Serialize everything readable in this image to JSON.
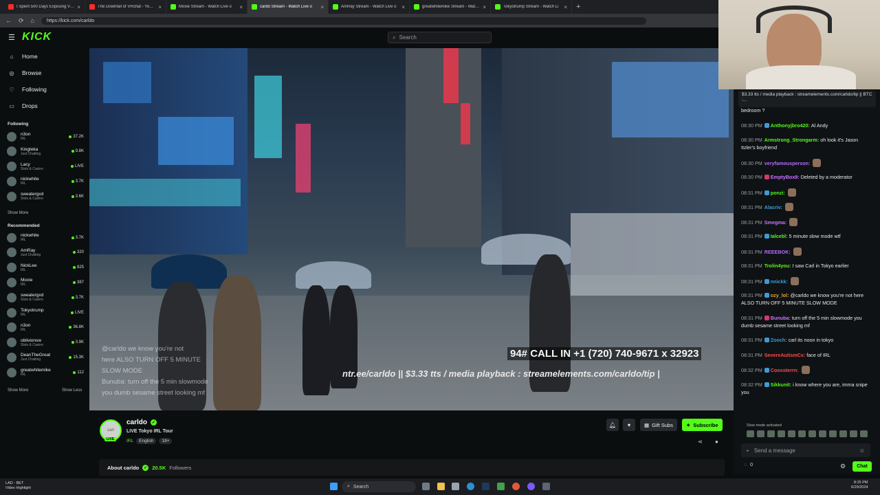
{
  "browser": {
    "tabs": [
      {
        "title": "I Spent 500 Days Exposing VRChat",
        "favicon_color": "#ff2b2b",
        "active": false
      },
      {
        "title": "The Downfall of VRchat - YouTube",
        "favicon_color": "#ff2b2b",
        "active": false
      },
      {
        "title": "Moxie Stream - Watch Live o",
        "favicon_color": "#53fc18",
        "active": false
      },
      {
        "title": "cardo Stream - Watch Live o",
        "favicon_color": "#53fc18",
        "active": true
      },
      {
        "title": "AmRay Stream - Watch Live o",
        "favicon_color": "#53fc18",
        "active": false
      },
      {
        "title": "greatwhitemike Stream - Watch Li",
        "favicon_color": "#53fc18",
        "active": false
      },
      {
        "title": "Tokyotrump Stream - Watch Li",
        "favicon_color": "#53fc18",
        "active": false
      }
    ],
    "url": "https://kick.com/carldo",
    "new_tab": "+"
  },
  "header": {
    "logo": "KICK",
    "search_placeholder": "Search"
  },
  "sidebar": {
    "nav": [
      {
        "label": "Home",
        "icon": "home-icon",
        "glyph": "⌂"
      },
      {
        "label": "Browse",
        "icon": "browse-icon",
        "glyph": "◎"
      },
      {
        "label": "Following",
        "icon": "heart-icon",
        "glyph": "♡"
      },
      {
        "label": "Drops",
        "icon": "drops-icon",
        "glyph": "▭"
      }
    ],
    "following_title": "Following",
    "following": [
      {
        "name": "n3on",
        "category": "IRL",
        "viewers": "37.2K"
      },
      {
        "name": "Kingteka",
        "category": "Just Chatting",
        "viewers": "9.8K"
      },
      {
        "name": "Lacy",
        "category": "Slots & Casino",
        "viewers": "LIVE"
      },
      {
        "name": "nickwhite",
        "category": "IRL",
        "viewers": "3.7K"
      },
      {
        "name": "sweatergxd",
        "category": "Slots & Casino",
        "viewers": "3.6K"
      }
    ],
    "show_more_1": "Show More",
    "recommended_title": "Recommended",
    "recommended": [
      {
        "name": "nickwhite",
        "category": "IRL",
        "viewers": "3.7K"
      },
      {
        "name": "AmRay",
        "category": "Just Chatting",
        "viewers": "320"
      },
      {
        "name": "NickLee",
        "category": "IRL",
        "viewers": "825"
      },
      {
        "name": "Moxie",
        "category": "IRL",
        "viewers": "387"
      },
      {
        "name": "sweatergxd",
        "category": "Slots & Casino",
        "viewers": "3.7K"
      },
      {
        "name": "Tokyotrump",
        "category": "IRL",
        "viewers": "LIVE"
      },
      {
        "name": "n3on",
        "category": "IRL",
        "viewers": "36.8K"
      },
      {
        "name": "oblivionsw",
        "category": "Slots & Casino",
        "viewers": "3.9K"
      },
      {
        "name": "DeanTheGreat",
        "category": "Just Chatting",
        "viewers": "15.3K"
      },
      {
        "name": "greatwhitemike",
        "category": "IRL",
        "viewers": "112"
      }
    ],
    "show_more_2": "Show More",
    "show_less": "Show Less"
  },
  "video": {
    "overlay_chat": [
      "@carldo we know you're not",
      "here ALSO TURN OFF 5 MINUTE",
      "SLOW MODE",
      "Bunuba: turn off the 5 min slowmode",
      "you dumb sesame street looking mf"
    ],
    "ticker_line1": "94#  CALL IN +1 (720) 740-9671 x 32923",
    "ticker_line2": "ntr.ee/carldo || $3.33 tts / media playback : streamelements.com/carldo/tip |"
  },
  "stream": {
    "avatar_text": "carl",
    "live_badge": "LIVE",
    "name": "carldo",
    "title": "LIVE Tokyo IRL Tour",
    "category": "IRL",
    "language": "English",
    "rating": "18+",
    "gift_label": "Gift Subs",
    "subscribe_label": "Subscribe",
    "about_label": "About carldo",
    "followers_count": "20.5K",
    "followers_label": "Followers"
  },
  "chat": {
    "pinned": "$3.33 tts / media playback : streamelements.com/carldo/tip || BTC :...",
    "messages": [
      {
        "time": "",
        "user": "",
        "color": "#e8e8e8",
        "text": "bedroom ?",
        "badge": ""
      },
      {
        "time": "08:30 PM",
        "user": "Anthonyjbro420:",
        "color": "#53fc18",
        "text": "Al Andy",
        "badge": "#3d9bd6"
      },
      {
        "time": "08:30 PM",
        "user": "Armstrong_Strongarm:",
        "color": "#53fc18",
        "text": "oh look it's Jason Itzler's boyfriend",
        "badge": ""
      },
      {
        "time": "08:30 PM",
        "user": "veryfamousperson:",
        "color": "#b36bff",
        "text": "",
        "badge": "",
        "emote": true
      },
      {
        "time": "08:30 PM",
        "user": "EmptyBox9:",
        "color": "#c774ff",
        "text": "Deleted by a moderator",
        "badge": "#d6386f"
      },
      {
        "time": "08:31 PM",
        "user": "ponzi:",
        "color": "#53fc18",
        "text": "",
        "badge": "#3d9bd6",
        "emote": true
      },
      {
        "time": "08:31 PM",
        "user": "Alacriv:",
        "color": "#3d9bd6",
        "text": "",
        "badge": "",
        "emote": true
      },
      {
        "time": "08:31 PM",
        "user": "Smegma:",
        "color": "#c774ff",
        "text": "",
        "badge": "",
        "emote": true
      },
      {
        "time": "08:31 PM",
        "user": "Ialcebl:",
        "color": "#53fc18",
        "text": "5 minute slow mode wtf",
        "badge": "#3d9bd6"
      },
      {
        "time": "08:31 PM",
        "user": "REEEBOK:",
        "color": "#b36bff",
        "text": "",
        "badge": "",
        "emote": true
      },
      {
        "time": "08:31 PM",
        "user": "Trolin4you:",
        "color": "#53fc18",
        "text": "I saw Carl in Tokyo earlier",
        "badge": ""
      },
      {
        "time": "08:31 PM",
        "user": "nnickk:",
        "color": "#3d9bd6",
        "text": "",
        "badge": "#3d9bd6",
        "emote": true
      },
      {
        "time": "08:31 PM",
        "user": "ozy_lol:",
        "color": "#e0a43a",
        "text": "@carldo we know you're not here ALSO TURN OFF 5 MINUTE SLOW MODE",
        "badge": "#3d9bd6"
      },
      {
        "time": "08:31 PM",
        "user": "Bunuba:",
        "color": "#c774ff",
        "text": "turn off the 5 min slowmode you dumb sesame street looking mf",
        "badge": "#d6386f"
      },
      {
        "time": "08:31 PM",
        "user": "Zooch:",
        "color": "#3d9bd6",
        "text": "carl its noon in tokyo",
        "badge": "#3d9bd6"
      },
      {
        "time": "08:31 PM",
        "user": "SevereAutismCx:",
        "color": "#ff4a4a",
        "text": "face of IRL",
        "badge": ""
      },
      {
        "time": "08:32 PM",
        "user": "Coossterrn:",
        "color": "#ff4a4a",
        "text": "",
        "badge": "#3d9bd6",
        "emote": true
      },
      {
        "time": "08:32 PM",
        "user": "Sikkunit:",
        "color": "#53fc18",
        "text": "i know where you are, imma snipe you",
        "badge": "#3d9bd6"
      }
    ],
    "slow_mode": "Slow mode activated",
    "input_placeholder": "Send a message",
    "count": "0",
    "chat_button": "Chat"
  },
  "taskbar": {
    "left_line1": "LAD - BET",
    "left_line2": "Video Highlight",
    "search": "Search",
    "time": "8:25 PM",
    "date": "6/29/2024"
  }
}
